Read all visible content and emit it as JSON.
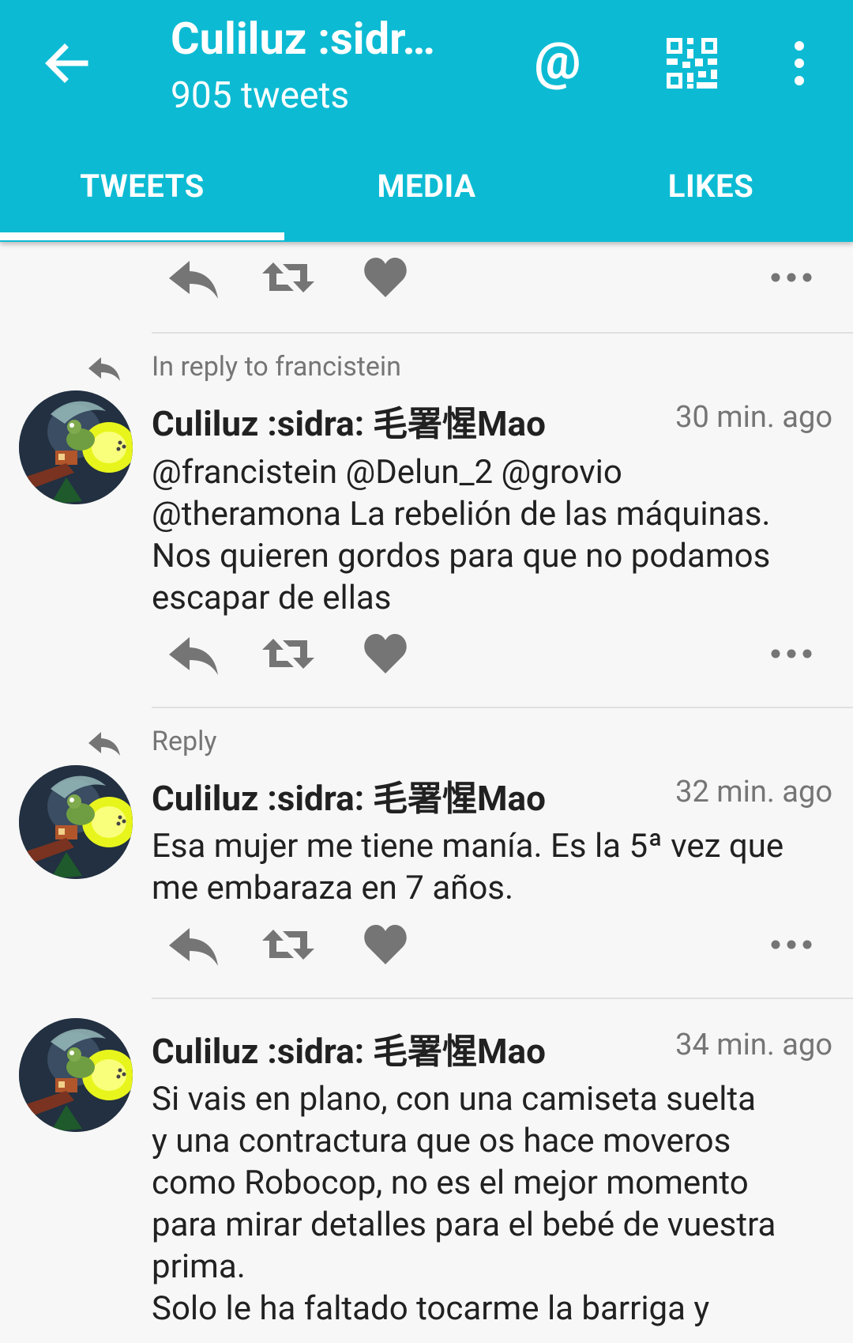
{
  "colors": {
    "accent": "#0cbbd3",
    "text": "#212121",
    "muted": "#757575",
    "icon": "#757575"
  },
  "header": {
    "title": "Culiluz :sidr…",
    "subtitle": "905 tweets",
    "icons": [
      "back-arrow-icon",
      "mention-icon",
      "qr-code-icon",
      "overflow-menu-icon"
    ],
    "at_symbol": "@"
  },
  "tabs": [
    {
      "label": "TWEETS",
      "selected": true
    },
    {
      "label": "MEDIA",
      "selected": false
    },
    {
      "label": "LIKES",
      "selected": false
    }
  ],
  "tweets": [
    {
      "context": "In reply to francistein",
      "author": "Culiluz :sidra: 毛署惺Mao",
      "time": "30 min. ago",
      "lines": [
        "@francistein @Delun_2 @grovio",
        "@theramona La rebelión de las máquinas.",
        "Nos quieren gordos para que no podamos",
        "escapar de ellas"
      ]
    },
    {
      "context": "Reply",
      "author": "Culiluz :sidra: 毛署惺Mao",
      "time": "32 min. ago",
      "lines": [
        "Esa mujer me tiene manía. Es la 5ª vez que",
        "me embaraza en 7 años."
      ]
    },
    {
      "context": "",
      "author": "Culiluz :sidra: 毛署惺Mao",
      "time": "34 min. ago",
      "lines": [
        "Si vais en plano, con una camiseta suelta",
        "y una contractura que os hace moveros",
        "como Robocop, no es el mejor momento",
        "para mirar detalles para el bebé de vuestra",
        "prima.",
        "Solo le ha faltado tocarme la barriga y"
      ]
    }
  ]
}
